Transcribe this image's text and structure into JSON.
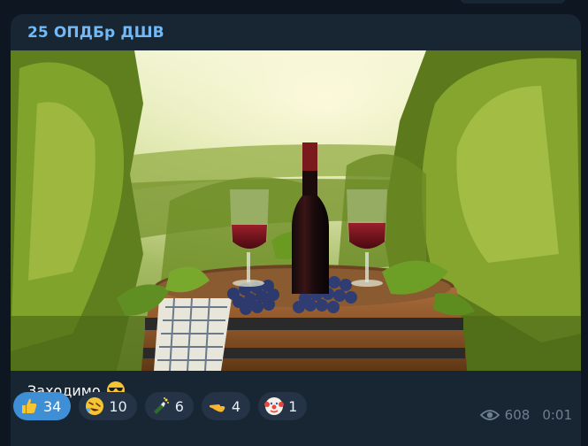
{
  "channel": {
    "name": "25 ОПДБр ДШВ"
  },
  "post": {
    "caption": "Заходимо",
    "caption_emoji": "smiling-face-with-sunglasses"
  },
  "reactions": [
    {
      "icon": "thumbs-up",
      "count": "34",
      "active": true
    },
    {
      "icon": "rolling-on-floor-laughing",
      "count": "10",
      "active": false
    },
    {
      "icon": "champagne-bottle",
      "count": "6",
      "active": false
    },
    {
      "icon": "pointing-hand",
      "count": "4",
      "active": false
    },
    {
      "icon": "clown-face",
      "count": "1",
      "active": false
    }
  ],
  "meta": {
    "views": "608",
    "time": "0:01"
  },
  "colors": {
    "accent": "#71baf7",
    "active_reaction": "#3f8fd6",
    "bubble": "#182533",
    "background": "#0e1621"
  }
}
